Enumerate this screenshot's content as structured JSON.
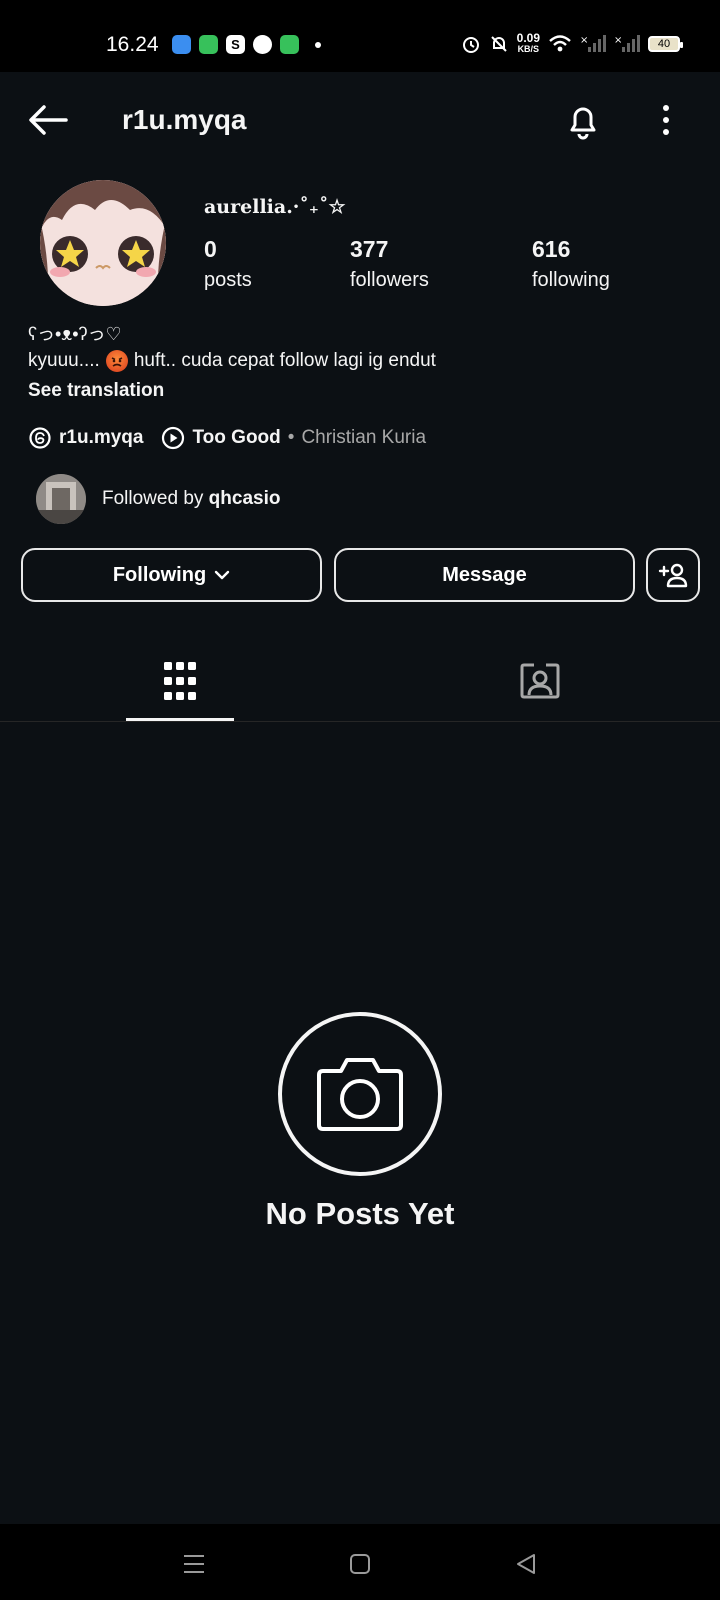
{
  "status_bar": {
    "time": "16.24",
    "net_speed_value": "0.09",
    "net_speed_unit": "KB/S",
    "battery": "40",
    "app_icons": [
      "blue-app-icon",
      "green-app-icon",
      "shop-bag-icon",
      "pinterest-icon",
      "chat-icon"
    ]
  },
  "header": {
    "username": "r1u.myqa"
  },
  "profile": {
    "display_name": "aurellia.·˚₊˚☆",
    "stats": [
      {
        "value": "0",
        "label": "posts"
      },
      {
        "value": "377",
        "label": "followers"
      },
      {
        "value": "616",
        "label": "following"
      }
    ],
    "bio_line1": "ʕっ•ᴥ•ʔっ♡",
    "bio_line2_before": "kyuuu....",
    "bio_line2_after": " huft.. cuda cepat follow lagi ig endut",
    "see_translation": "See translation",
    "threads_handle": "r1u.myqa",
    "song_title": "Too Good",
    "song_separator": "•",
    "song_artist": "Christian Kuria",
    "followed_by_prefix": "Followed by ",
    "followed_by_user": "qhcasio"
  },
  "actions": {
    "following_label": "Following",
    "message_label": "Message"
  },
  "empty_state": {
    "title": "No Posts Yet"
  },
  "colors": {
    "background": "#0c1014",
    "text": "#f5f5f5",
    "secondary_text": "#a8a8a8"
  }
}
